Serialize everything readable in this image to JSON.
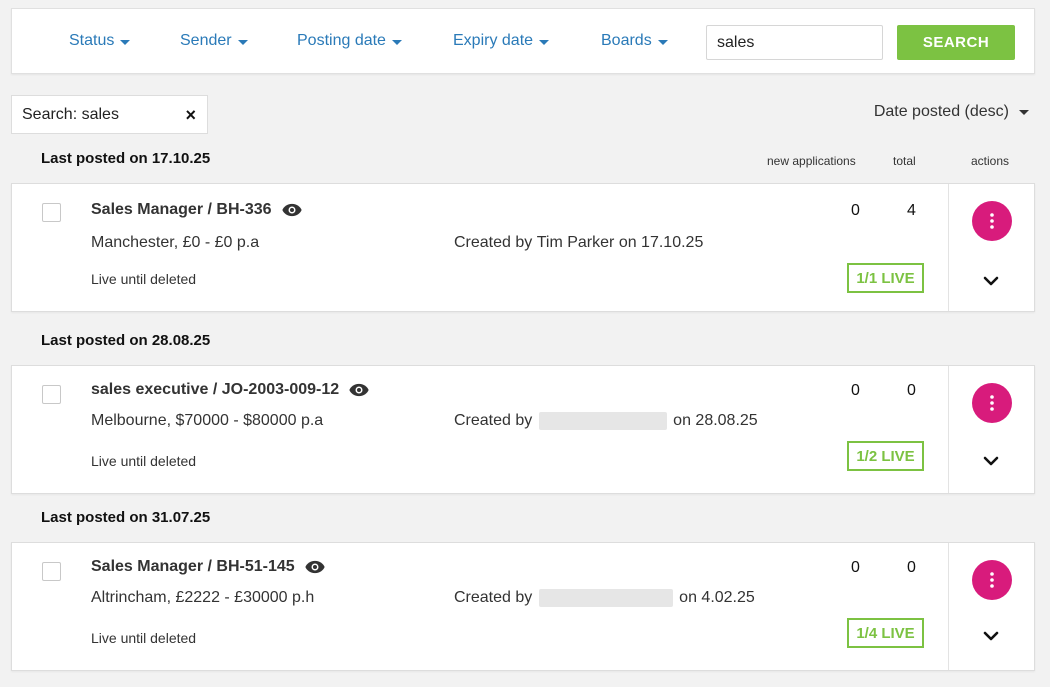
{
  "filters": {
    "status": "Status",
    "sender": "Sender",
    "posting_date": "Posting date",
    "expiry_date": "Expiry date",
    "boards": "Boards",
    "search_value": "sales",
    "search_button": "SEARCH"
  },
  "active_filter": {
    "label": "Search: sales",
    "remove": "×"
  },
  "sort": {
    "label": "Date posted (desc)"
  },
  "columns": {
    "new_applications": "new applications",
    "total": "total",
    "actions": "actions"
  },
  "groups": [
    {
      "title": "Last posted on 17.10.25",
      "job": {
        "title": "Sales Manager / BH-336",
        "location": "Manchester, £0 - £0 p.a",
        "created_prefix": "Created by",
        "created_name": "Tim Parker",
        "created_suffix": "on 17.10.25",
        "live_until": "Live until deleted",
        "new_applications": "0",
        "total": "4",
        "live_status": "1/1 LIVE"
      }
    },
    {
      "title": "Last posted on 28.08.25",
      "job": {
        "title": "sales executive / JO-2003-009-12",
        "location": "Melbourne, $70000 - $80000 p.a",
        "created_prefix": "Created by",
        "created_name": "",
        "created_suffix": "on 28.08.25",
        "live_until": "Live until deleted",
        "new_applications": "0",
        "total": "0",
        "live_status": "1/2 LIVE"
      }
    },
    {
      "title": "Last posted on 31.07.25",
      "job": {
        "title": "Sales Manager / BH-51-145",
        "location": "Altrincham, £2222 - £30000 p.h",
        "created_prefix": "Created by",
        "created_name": "",
        "created_suffix": "on 4.02.25",
        "live_until": "Live until deleted",
        "new_applications": "0",
        "total": "0",
        "live_status": "1/4 LIVE"
      }
    }
  ],
  "colors": {
    "link": "#2a7ab8",
    "search_button": "#7cc242",
    "live": "#7cc242",
    "actions": "#d81b7c"
  }
}
